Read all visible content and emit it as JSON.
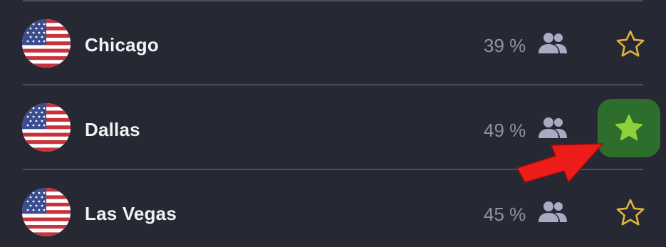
{
  "servers": [
    {
      "city": "Chicago",
      "load": "39 %",
      "favorite": false,
      "flag": "us-flag-icon"
    },
    {
      "city": "Dallas",
      "load": "49 %",
      "favorite": true,
      "flag": "us-flag-icon"
    },
    {
      "city": "Las Vegas",
      "load": "45 %",
      "favorite": false,
      "flag": "us-flag-icon"
    }
  ],
  "colors": {
    "background": "#262833",
    "divider": "#4a4d5c",
    "city_text": "#f2f2f5",
    "load_text": "#8f92a3",
    "users_icon": "#a9abc4",
    "star_outline": "#e0b43c",
    "favorite_bg": "#2e6e2d",
    "favorite_star": "#8fd13b",
    "arrow": "#ee1b1b"
  },
  "icons": {
    "users": "users-icon",
    "favorite": "star-icon",
    "annotation": "red-arrow-icon"
  }
}
